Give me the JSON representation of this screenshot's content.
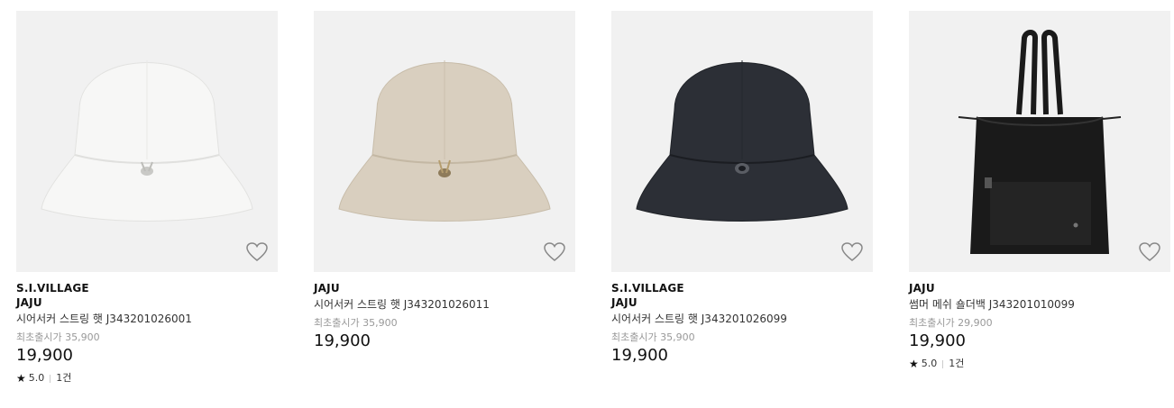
{
  "products": [
    {
      "brand_lines": [
        "S.I.VILLAGE",
        "JAJU"
      ],
      "name": "시어서커 스트링 햇 J343201026001",
      "original_price_label": "최초출시가 35,900",
      "price": "19,900",
      "rating": "5.0",
      "review_count": "1건",
      "image": {
        "kind": "bucket-hat",
        "color": "#f7f7f6",
        "shade": "#dcdcda"
      },
      "wishlist_icon": "heart-outline-icon"
    },
    {
      "brand_lines": [
        "JAJU"
      ],
      "name": "시어서커 스트링 햇 J343201026011",
      "original_price_label": "최초출시가 35,900",
      "price": "19,900",
      "image": {
        "kind": "bucket-hat",
        "color": "#d9cfbf",
        "shade": "#bfb3a0"
      },
      "wishlist_icon": "heart-outline-icon"
    },
    {
      "brand_lines": [
        "S.I.VILLAGE",
        "JAJU"
      ],
      "name": "시어서커 스트링 햇 J343201026099",
      "original_price_label": "최초출시가 35,900",
      "price": "19,900",
      "image": {
        "kind": "bucket-hat",
        "color": "#2c2f36",
        "shade": "#1b1d22"
      },
      "wishlist_icon": "heart-outline-icon"
    },
    {
      "brand_lines": [
        "JAJU"
      ],
      "name": "썸머 메쉬 숄더백 J343201010099",
      "original_price_label": "최초출시가 29,900",
      "price": "19,900",
      "rating": "5.0",
      "review_count": "1건",
      "image": {
        "kind": "tote-bag",
        "color": "#1a1a1a",
        "shade": "#0c0c0c"
      },
      "wishlist_icon": "heart-outline-icon"
    }
  ]
}
